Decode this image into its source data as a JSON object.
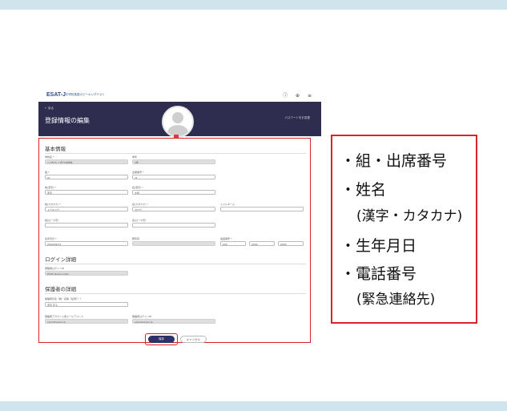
{
  "header": {
    "logo": "ESAT-J",
    "logo_sub": "中学校英語スピーキングテスト",
    "icons": [
      "info-icon",
      "globe-icon",
      "menu-icon"
    ],
    "icon_glyphs": "ⓘ ⊕ ≡"
  },
  "banner": {
    "back": "← 戻る",
    "title": "登録情報の編集",
    "right_link": "パスワードをお変更"
  },
  "form": {
    "basic_title": "基本情報",
    "school_label": "学校名 *",
    "school_value": "○○市立○○区立中学校",
    "grade_label": "学年",
    "grade_value": "3年",
    "class_label": "組 *",
    "class_value": "01",
    "number_label": "出席番号 *",
    "number_value": "11",
    "last_label": "姓(漢字) *",
    "last_value": "東京",
    "first_label": "名(漢字) *",
    "first_value": "太郎",
    "last_kana_label": "姓(カタカナ) *",
    "last_kana_value": "トウキョウ",
    "first_kana_label": "名(カタカナ) *",
    "first_kana_value": "タロウ",
    "middle_label": "ミドルネーム",
    "last_roman_label": "姓(ローマ字)",
    "first_roman_label": "名(ローマ字)",
    "birth_label": "生年月日 *",
    "birth_value": "2009/04/01",
    "photo_label": "顔写真",
    "phone_label": "電話番号 *",
    "phone_1": "090",
    "phone_2": "0000",
    "phone_3": "0000",
    "login_title": "ログイン詳細",
    "login_id_label": "受験者ログインID",
    "login_id_value": "ESAT-Jdemo-Login",
    "guardian_title": "保護者の詳細",
    "guardian_name_label": "保護者氏名（姓・名等（任意））*",
    "guardian_name_value": "東京 花子",
    "guardian_email_label": "保護者アカウント用メールアドレス",
    "guardian_email_value": "xxxx@xxxxx.jp",
    "guardian_login_label": "保護者ログインID",
    "guardian_login_value": "xxxx@xxxxx.jp"
  },
  "buttons": {
    "save": "保存",
    "cancel": "キャンセル"
  },
  "callout": {
    "item1": "・組・出席番号",
    "item2": "・姓名",
    "item2_sub": "(漢字・カタカナ)",
    "item3": "・生年月日",
    "item4": "・電話番号",
    "item4_sub": "(緊急連絡先)"
  },
  "colors": {
    "accent_red": "#d9242a",
    "banner": "#2e2c4f",
    "band": "#cfe4ec"
  }
}
